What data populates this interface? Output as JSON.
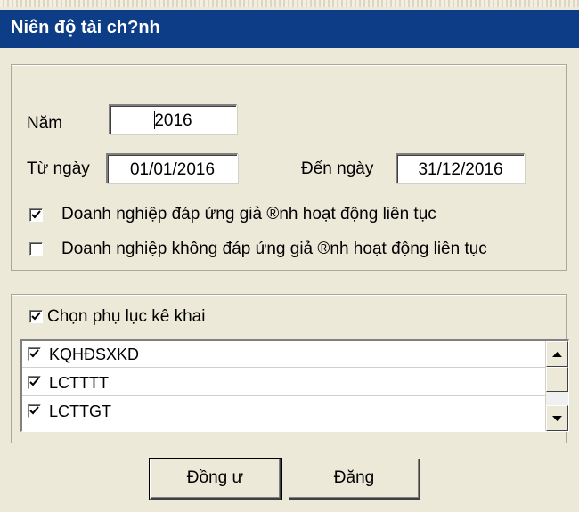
{
  "window": {
    "title": "Niên độ tài ch?nh"
  },
  "fiscal": {
    "year_label": "Năm",
    "year_value": "2016",
    "from_label": "Từ ngày",
    "from_value": "01/01/2016",
    "to_label": "Đến ngày",
    "to_value": "31/12/2016",
    "going_concern": {
      "label": "Doanh nghiệp đáp ứng giả ®nh hoạt động liên tục",
      "checked": true
    },
    "not_going_concern": {
      "label": "Doanh nghiệp không đáp ứng giả ®nh hoạt động liên tục",
      "checked": false
    }
  },
  "appendix": {
    "select_label": "Chọn phụ lục kê khai",
    "select_checked": true,
    "items": [
      {
        "label": "KQHĐSXKD",
        "checked": true
      },
      {
        "label": "LCTTTT",
        "checked": true
      },
      {
        "label": "LCTTGT",
        "checked": true
      }
    ]
  },
  "buttons": {
    "ok_label": "Đồng ư",
    "cancel_prefix": "Đă",
    "cancel_mnemonic": "n",
    "cancel_suffix": "g"
  },
  "icons": {
    "check": "checkmark-icon",
    "scroll_up": "arrow-up-icon",
    "scroll_down": "arrow-down-icon"
  }
}
